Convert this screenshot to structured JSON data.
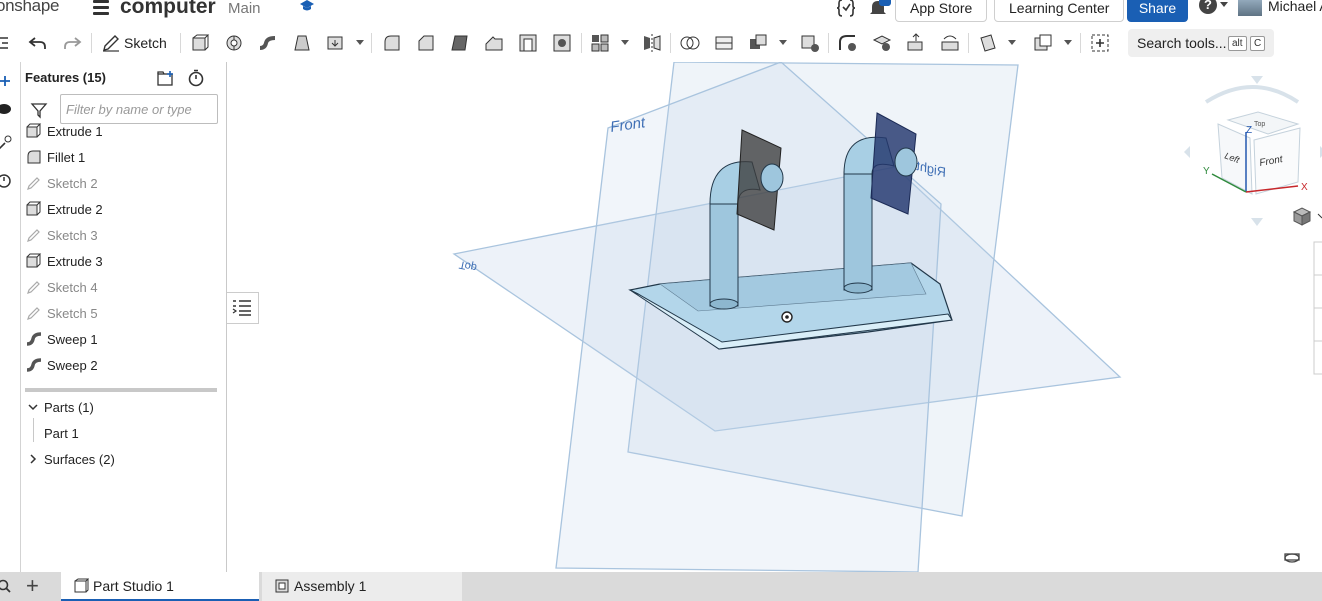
{
  "header": {
    "logo": "onshape",
    "document_name": "computer",
    "branch": "Main",
    "app_store": "App Store",
    "learning_center": "Learning Center",
    "share": "Share",
    "help": "?",
    "user": "Michael A",
    "accent_color": "#1a5fb4"
  },
  "toolbar": {
    "sketch_label": "Sketch",
    "search_tools": "Search tools...",
    "shortcut_keys": [
      "alt",
      "C"
    ],
    "icons": [
      "undo-icon",
      "redo-icon",
      "sketch-pencil-icon",
      "extrude-icon",
      "revolve-icon",
      "sweep-icon",
      "loft-icon",
      "thicken-icon",
      "fillet-icon",
      "chamfer-icon",
      "draft-icon",
      "rib-icon",
      "shell-icon",
      "hole-icon",
      "pattern-icon",
      "mirror-icon",
      "boolean-icon",
      "split-icon",
      "transform-icon",
      "delete-part-icon",
      "modify-fillet-icon",
      "delete-face-icon",
      "move-face-icon",
      "replace-face-icon",
      "plane-icon",
      "mate-connector-icon",
      "insert-icon"
    ]
  },
  "features_panel": {
    "title": "Features (15)",
    "filter_placeholder": "Filter by name or type",
    "features": [
      {
        "name": "Extrude 1",
        "icon": "extrude-icon",
        "dim": false
      },
      {
        "name": "Fillet 1",
        "icon": "fillet-icon",
        "dim": false
      },
      {
        "name": "Sketch 2",
        "icon": "sketch-icon",
        "dim": true
      },
      {
        "name": "Extrude 2",
        "icon": "extrude-icon",
        "dim": false
      },
      {
        "name": "Sketch 3",
        "icon": "sketch-icon",
        "dim": true
      },
      {
        "name": "Extrude 3",
        "icon": "extrude-icon",
        "dim": false
      },
      {
        "name": "Sketch 4",
        "icon": "sketch-icon",
        "dim": true
      },
      {
        "name": "Sketch 5",
        "icon": "sketch-icon",
        "dim": true
      },
      {
        "name": "Sweep 1",
        "icon": "sweep-icon",
        "dim": false
      },
      {
        "name": "Sweep 2",
        "icon": "sweep-icon",
        "dim": false
      }
    ],
    "parts_label": "Parts (1)",
    "part_name": "Part 1",
    "surfaces_label": "Surfaces (2)"
  },
  "viewport": {
    "planes": {
      "front": "Front",
      "top": "Top",
      "right": "Right"
    },
    "view_cube": {
      "top": "Top",
      "front": "Front",
      "left": "Left"
    },
    "axes": {
      "x": "X",
      "y": "Y",
      "z": "Z"
    },
    "plane_color": "#a9c4de",
    "part_color": "#a6cde4"
  },
  "tabs": [
    {
      "label": "Part Studio 1",
      "active": true
    },
    {
      "label": "Assembly 1",
      "active": false
    }
  ]
}
